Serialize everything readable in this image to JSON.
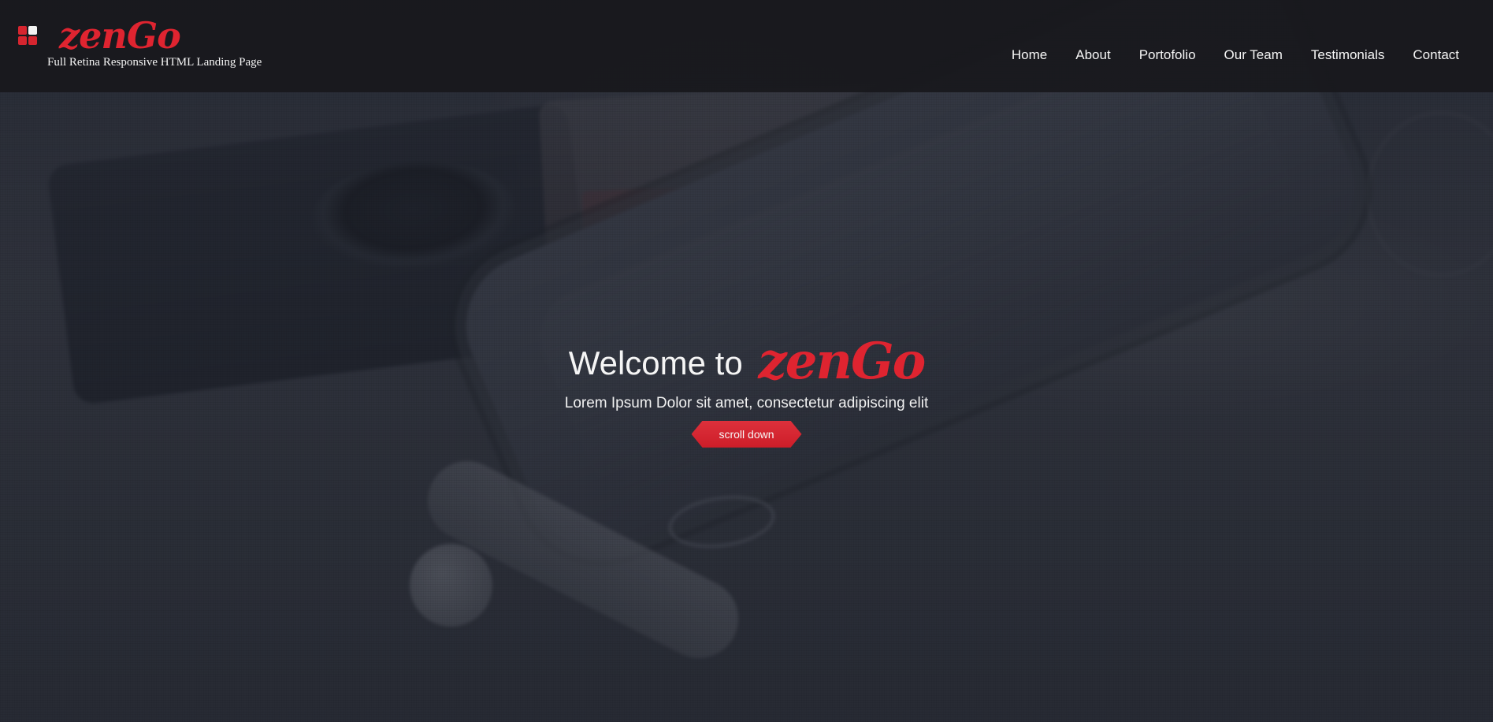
{
  "header": {
    "brand": {
      "name": "zenGo",
      "tagline": "Full Retina Responsive HTML Landing Page",
      "logo_icon": "four-square-logo-icon"
    },
    "nav": [
      {
        "label": "Home"
      },
      {
        "label": "About"
      },
      {
        "label": "Portofolio"
      },
      {
        "label": "Our Team"
      },
      {
        "label": "Testimonials"
      },
      {
        "label": "Contact"
      }
    ]
  },
  "hero": {
    "title_prefix": "Welcome to",
    "title_brand": "zenGo",
    "subtitle": "Lorem Ipsum Dolor sit amet, consectetur adipiscing elit",
    "cta_label": "scroll down"
  },
  "colors": {
    "accent": "#df2430",
    "header_bg": "#18181c",
    "text": "#f5f5f5"
  }
}
